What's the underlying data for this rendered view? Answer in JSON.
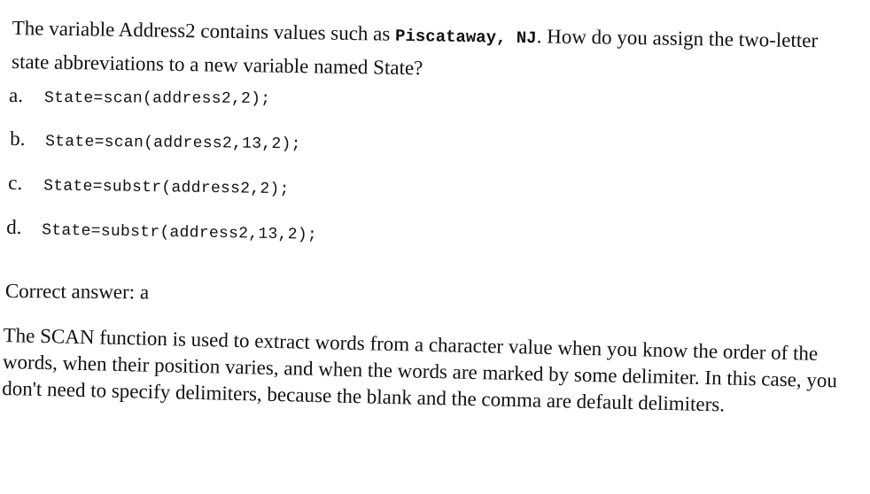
{
  "question": {
    "text_before": "The variable Address2 contains values such as ",
    "code_value": "Piscataway, NJ",
    "text_after": ". How do you assign the two-letter state abbreviations to a new variable named State?"
  },
  "options": [
    {
      "letter": "a.",
      "code": "State=scan(address2,2);"
    },
    {
      "letter": "b.",
      "code": "State=scan(address2,13,2);"
    },
    {
      "letter": "c.",
      "code": "State=substr(address2,2);"
    },
    {
      "letter": "d.",
      "code": "State=substr(address2,13,2);"
    }
  ],
  "answer": {
    "text": "Correct answer: a"
  },
  "explanation": {
    "text": "The SCAN function is used to extract words from a character value when you know the order of the words, when their position varies, and when the words are marked by some delimiter. In this case, you don't need to specify delimiters, because the blank and the comma are default delimiters."
  }
}
